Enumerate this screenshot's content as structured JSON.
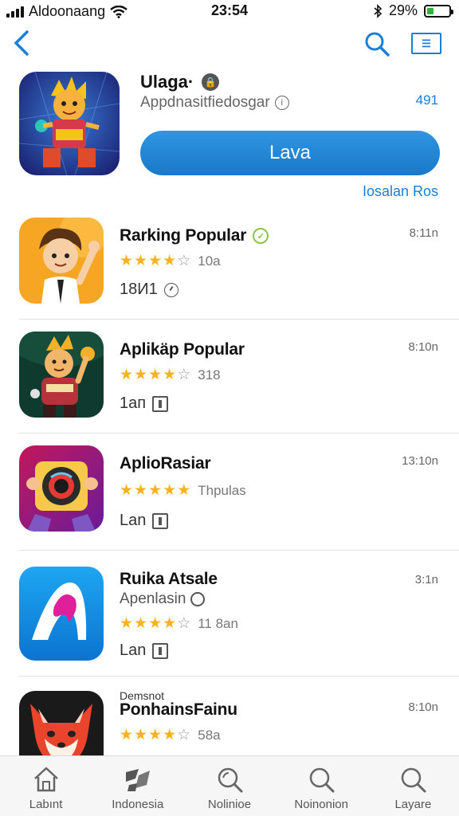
{
  "status": {
    "carrier": "Aldoonaang",
    "time": "23:54",
    "battery": "29%",
    "battery_level": 0.29
  },
  "featured": {
    "title": "Ulaga·",
    "subtitle": "Appdnasitfiedosgar",
    "count": "491",
    "button": "Lava",
    "link": "Iosalan Ros",
    "icon": "cartoon-hero-icon"
  },
  "apps": [
    {
      "name": "Rarking Popular",
      "meta": "8:11n",
      "rating": 4,
      "rating_label": "10a",
      "foot": "18И1",
      "icon": "boy-character-icon"
    },
    {
      "name": "Aplikäp Popular",
      "meta": "8:10n",
      "rating": 4,
      "rating_label": "318",
      "foot": "1aп",
      "icon": "girl-character-icon"
    },
    {
      "name": "AplioRasiar",
      "meta": "13:10n",
      "rating": 5,
      "rating_label": "Thpulas",
      "foot": "Lan",
      "icon": "camera-lens-icon"
    },
    {
      "name": "Ruika Atsale",
      "meta": "3:1n",
      "subtitle": "Apenlasin",
      "rating": 3.5,
      "rating_label": "11 8an",
      "foot": "Lan",
      "icon": "letter-a-icon"
    },
    {
      "name": "PonhainsFainu",
      "small": "Demsnot",
      "meta": "8:10n",
      "rating": 4,
      "rating_label": "58a",
      "icon": "fox-icon"
    }
  ],
  "tabs": [
    {
      "label": "Labınt",
      "icon": "home-icon"
    },
    {
      "label": "Indonesia",
      "icon": "apps-icon"
    },
    {
      "label": "Nolinioe",
      "icon": "search-icon"
    },
    {
      "label": "Noinonion",
      "icon": "search-icon"
    },
    {
      "label": "Layare",
      "icon": "search-icon"
    }
  ],
  "colors": {
    "accent": "#1a7fd6",
    "star": "#f5b323",
    "battery": "#2fb43a"
  }
}
